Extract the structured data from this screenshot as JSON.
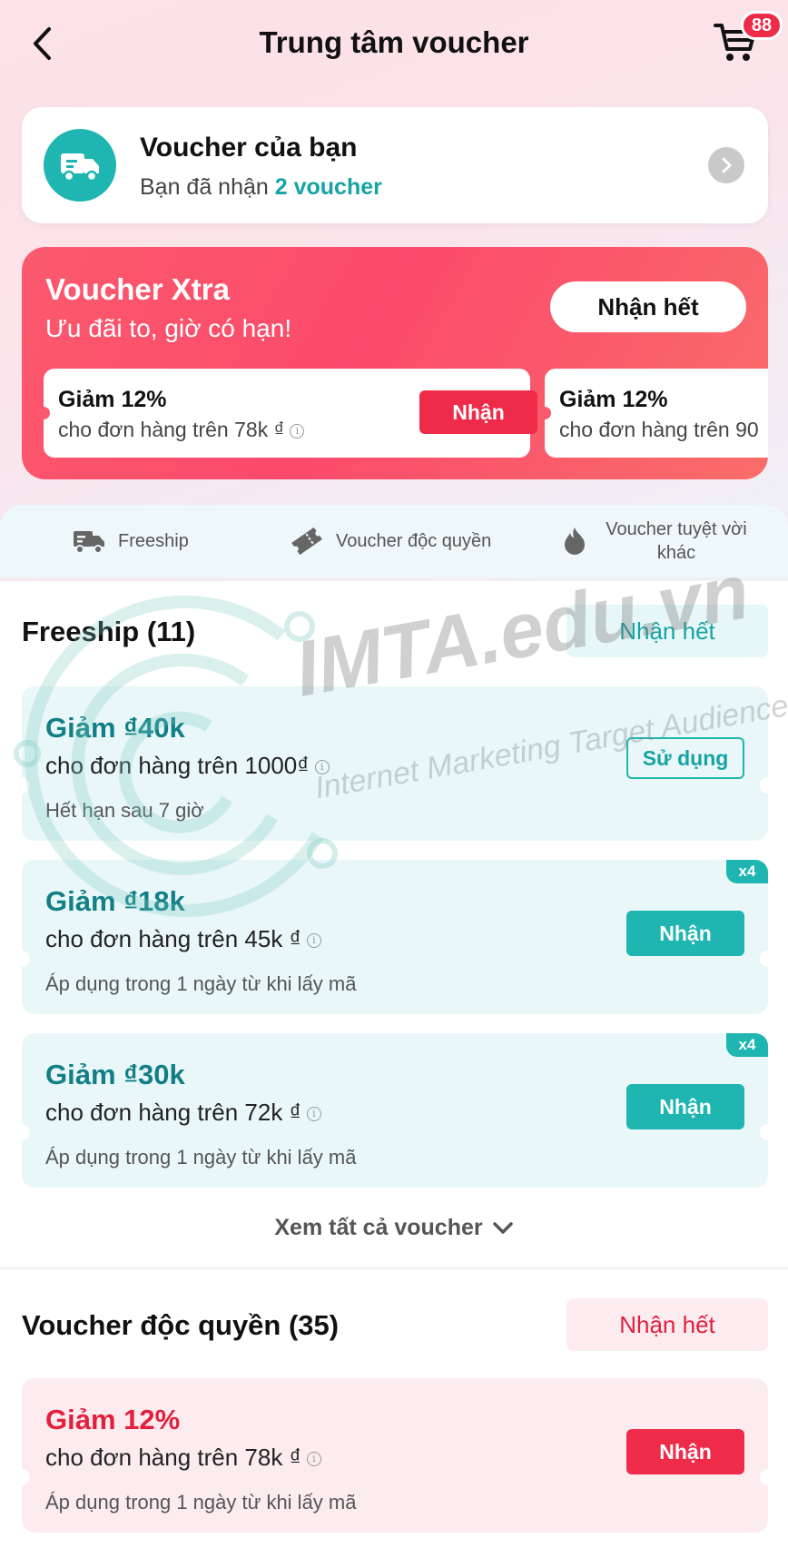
{
  "header": {
    "title": "Trung tâm voucher",
    "cart_badge": "88"
  },
  "my_voucher": {
    "title": "Voucher của bạn",
    "subtitle_prefix": "Bạn đã nhận",
    "count_text": "2 voucher"
  },
  "xtra": {
    "title": "Voucher Xtra",
    "subtitle": "Ưu đãi to, giờ có hạn!",
    "claim_all_label": "Nhận hết",
    "cards": [
      {
        "title": "Giảm 12%",
        "subtitle": "cho đơn hàng trên 78k ₫",
        "button": "Nhận"
      },
      {
        "title": "Giảm 12%",
        "subtitle": "cho đơn hàng trên 90"
      }
    ]
  },
  "categories": [
    {
      "label": "Freeship",
      "icon": "truck-icon"
    },
    {
      "label": "Voucher độc quyền",
      "icon": "ticket-icon"
    },
    {
      "label": "Voucher tuyệt vời khác",
      "icon": "flame-icon"
    }
  ],
  "freeship": {
    "title": "Freeship (11)",
    "claim_all_label": "Nhận hết",
    "vouchers": [
      {
        "title": "Giảm ₫40k",
        "subtitle": "cho đơn hàng trên 1000₫",
        "note": "Hết hạn sau 7 giờ",
        "button": "Sử dụng"
      },
      {
        "title": "Giảm ₫18k",
        "subtitle": "cho đơn hàng trên 45k ₫",
        "note": "Áp dụng trong 1 ngày từ khi lấy mã",
        "button": "Nhận",
        "qty": "x4"
      },
      {
        "title": "Giảm ₫30k",
        "subtitle": "cho đơn hàng trên 72k ₫",
        "note": "Áp dụng trong 1 ngày từ khi lấy mã",
        "button": "Nhận",
        "qty": "x4"
      }
    ],
    "see_all_label": "Xem tất cả voucher"
  },
  "exclusive": {
    "title": "Voucher độc quyền (35)",
    "claim_all_label": "Nhận hết",
    "vouchers": [
      {
        "title": "Giảm 12%",
        "subtitle": "cho đơn hàng trên 78k ₫",
        "note": "Áp dụng trong 1 ngày từ khi lấy mã",
        "button": "Nhận"
      }
    ]
  },
  "watermark": {
    "main": "IMTA.edu.vn",
    "sub": "Internet Marketing Target Audience"
  },
  "colors": {
    "teal": "#1fb5b1",
    "red": "#ee2c4a",
    "teal_text": "#127f86"
  }
}
